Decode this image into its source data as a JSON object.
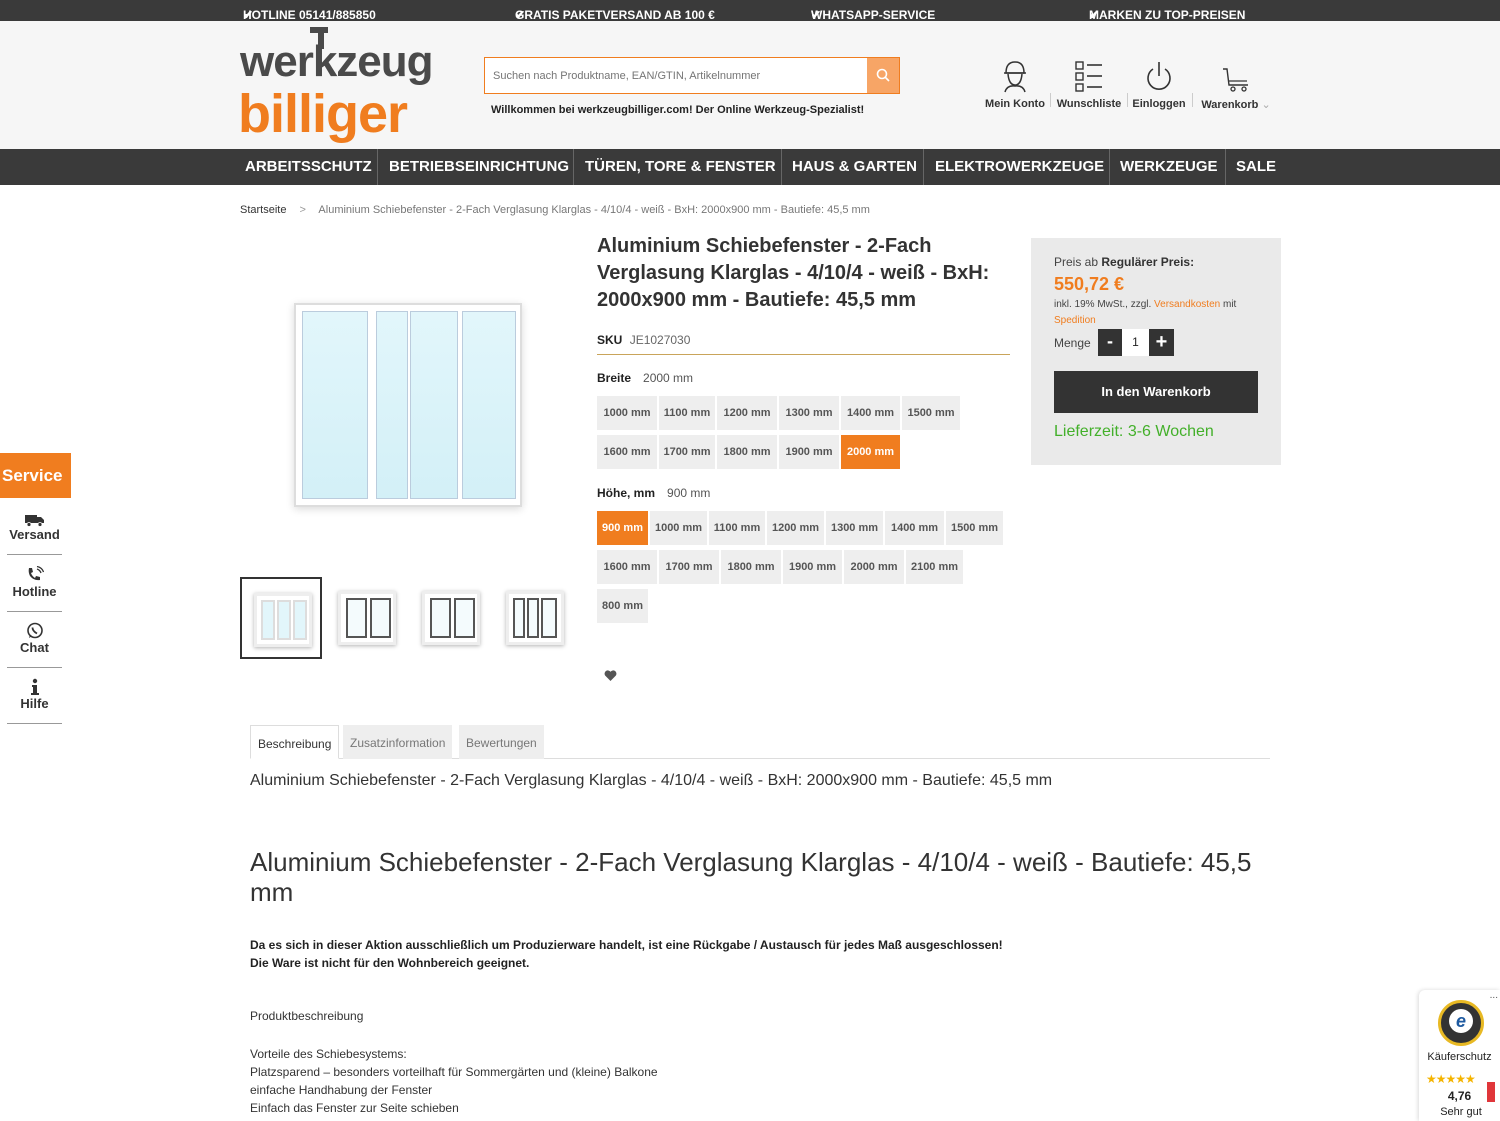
{
  "topbar": [
    "HOTLINE 05141/885850",
    "GRATIS PAKETVERSAND AB 100 €",
    "WHATSAPP-SERVICE",
    "MARKEN ZU TOP-PREISEN"
  ],
  "logo": {
    "line1": "werkzeug",
    "line2": "billiger"
  },
  "search": {
    "placeholder": "Suchen nach Produktname, EAN/GTIN, Artikelnummer"
  },
  "welcome": "Willkommen bei werkzeugbilliger.com! Der Online Werkzeug-Spezialist!",
  "header_icons": [
    {
      "label": "Mein Konto",
      "icon": "account-icon"
    },
    {
      "label": "Wunschliste",
      "icon": "wishlist-icon"
    },
    {
      "label": "Einloggen",
      "icon": "power-icon"
    },
    {
      "label": "Warenkorb",
      "icon": "cart-icon"
    }
  ],
  "nav": [
    "ARBEITSSCHUTZ",
    "BETRIEBSEINRICHTUNG",
    "TÜREN, TORE & FENSTER",
    "HAUS & GARTEN",
    "ELEKTROWERKZEUGE",
    "WERKZEUGE",
    "SALE"
  ],
  "breadcrumb": {
    "home": "Startseite",
    "separator": ">",
    "current": "Aluminium Schiebefenster - 2-Fach Verglasung Klarglas - 4/10/4 - weiß - BxH: 2000x900 mm - Bautiefe: 45,5 mm"
  },
  "product": {
    "title": "Aluminium Schiebefenster - 2-Fach Verglasung Klarglas - 4/10/4 - weiß - BxH: 2000x900 mm - Bautiefe: 45,5 mm",
    "sku_label": "SKU",
    "sku": "JE1027030"
  },
  "width_option": {
    "label": "Breite",
    "selected": "2000 mm",
    "options": [
      "1000 mm",
      "1100 mm",
      "1200 mm",
      "1300 mm",
      "1400 mm",
      "1500 mm",
      "1600 mm",
      "1700 mm",
      "1800 mm",
      "1900 mm",
      "2000 mm"
    ]
  },
  "height_option": {
    "label": "Höhe, mm",
    "selected": "900 mm",
    "options": [
      "900 mm",
      "1000 mm",
      "1100 mm",
      "1200 mm",
      "1300 mm",
      "1400 mm",
      "1500 mm",
      "1600 mm",
      "1700 mm",
      "1800 mm",
      "1900 mm",
      "2000 mm",
      "2100 mm",
      "800 mm"
    ]
  },
  "buybox": {
    "price_prefix": "Preis ab",
    "price_label": "Regulärer Preis:",
    "price": "550,72 €",
    "tax_text": "inkl. 19% MwSt., zzgl.",
    "shipping_link": "Versandkosten",
    "tax_mit": "mit",
    "spedition": "Spedition",
    "qty_label": "Menge",
    "qty_minus": "-",
    "qty": "1",
    "qty_plus": "+",
    "cart_button": "In den Warenkorb",
    "delivery": "Lieferzeit: 3-6 Wochen"
  },
  "service": {
    "title": "Service",
    "items": [
      {
        "label": "Versand",
        "icon": "truck-icon"
      },
      {
        "label": "Hotline",
        "icon": "phone-icon"
      },
      {
        "label": "Chat",
        "icon": "whatsapp-icon"
      },
      {
        "label": "Hilfe",
        "icon": "info-icon"
      }
    ]
  },
  "tabs": [
    "Beschreibung",
    "Zusatzinformation",
    "Bewertungen"
  ],
  "description": {
    "line": "Aluminium Schiebefenster - 2-Fach Verglasung Klarglas - 4/10/4 - weiß - BxH: 2000x900 mm - Bautiefe: 45,5 mm",
    "heading": "Aluminium Schiebefenster - 2-Fach Verglasung Klarglas - 4/10/4 - weiß - Bautiefe: 45,5 mm",
    "warning1": "Da es sich in dieser Aktion ausschließlich um Produzierware handelt, ist eine Rückgabe / Austausch für jedes Maß ausgeschlossen!",
    "warning2": "Die Ware ist nicht für den Wohnbereich geeignet.",
    "section": "Produktbeschreibung",
    "list": [
      "Vorteile des Schiebesystems:",
      "Platzsparend – besonders vorteilhaft für Sommergärten und (kleine) Balkone",
      "einfache Handhabung der Fenster",
      "Einfach das Fenster zur Seite schieben"
    ]
  },
  "trust": {
    "label": "Käuferschutz",
    "stars": "★★★★★",
    "rating": "4,76",
    "rating_text": "Sehr gut",
    "menu": "..."
  },
  "colors": {
    "accent": "#f07d1f",
    "dark": "#3a3a3a",
    "green": "#43b02a"
  }
}
